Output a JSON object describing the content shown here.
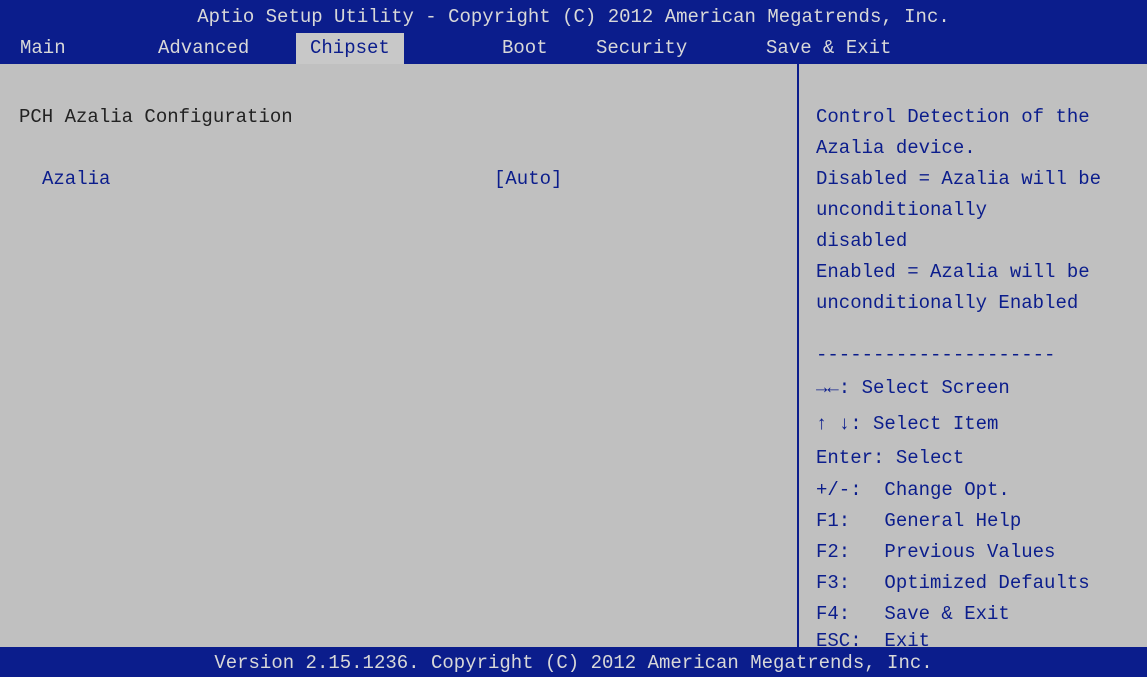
{
  "window": {
    "title": "Aptio Setup Utility - Copyright (C) 2012 American Megatrends, Inc."
  },
  "tabs": [
    {
      "label": "Main",
      "active": false
    },
    {
      "label": "Advanced",
      "active": false
    },
    {
      "label": "Chipset",
      "active": true
    },
    {
      "label": "Boot",
      "active": false
    },
    {
      "label": "Security",
      "active": false
    },
    {
      "label": "Save & Exit",
      "active": false
    }
  ],
  "main": {
    "section_title": "PCH Azalia Configuration",
    "items": [
      {
        "label": "Azalia",
        "value": "[Auto]"
      }
    ]
  },
  "help": {
    "lines": [
      "Control Detection of the",
      "Azalia device.",
      "Disabled = Azalia will be",
      "unconditionally",
      "disabled",
      "Enabled = Azalia will be",
      "unconditionally Enabled"
    ],
    "separator": "---------------------"
  },
  "keys": [
    "→←: Select Screen",
    "↑ ↓: Select Item",
    "Enter: Select",
    "+/-:  Change Opt.",
    "F1:   General Help",
    "F2:   Previous Values",
    "F3:   Optimized Defaults",
    "F4:   Save & Exit",
    "ESC:  Exit"
  ],
  "footer": {
    "text": "Version 2.15.1236. Copyright (C) 2012 American Megatrends, Inc."
  },
  "colors": {
    "frame": "#0b1d8c",
    "panel": "#c0c0c0",
    "highlight_text": "#0b1d8c",
    "frame_text": "#d8d8d8"
  }
}
